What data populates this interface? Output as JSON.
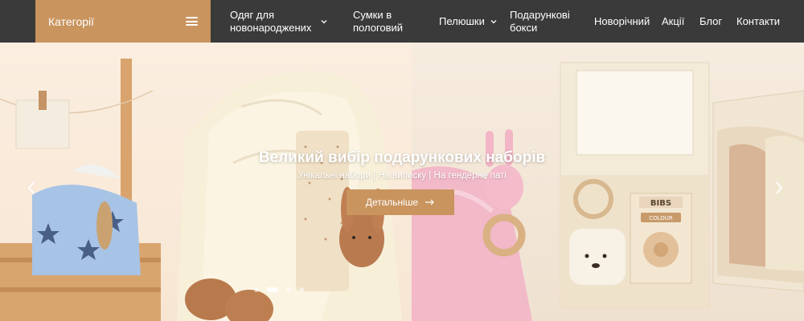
{
  "header": {
    "categories_label": "Категорії",
    "nav": [
      {
        "label_line1": "Одяг для",
        "label_line2": "новонароджених",
        "has_dropdown": true
      },
      {
        "label_line1": "Сумки в",
        "label_line2": "пологовий",
        "has_dropdown": false
      },
      {
        "label_line1": "Пелюшки",
        "label_line2": "",
        "has_dropdown": true
      },
      {
        "label_line1": "Подарункові",
        "label_line2": "бокси",
        "has_dropdown": false
      },
      {
        "label_line1": "Новорічний",
        "label_line2": "",
        "has_dropdown": false
      },
      {
        "label_line1": "Акції",
        "label_line2": "",
        "has_dropdown": false
      },
      {
        "label_line1": "Блог",
        "label_line2": "",
        "has_dropdown": false
      },
      {
        "label_line1": "Контакти",
        "label_line2": "",
        "has_dropdown": false
      }
    ]
  },
  "hero": {
    "title": "Великий вибір подарункових наборів",
    "subtitle": "Унікальні набори | На виписку | На гендерне паті",
    "button_label": "Детальніше",
    "slide_count": 4,
    "active_slide": 2,
    "icons": {
      "prev": "chevron-left-icon",
      "next": "chevron-right-icon",
      "button": "arrow-right-icon",
      "menu": "hamburger-icon"
    }
  },
  "colors": {
    "header_bg": "#3a3a3a",
    "accent": "#c9945e",
    "text_light": "#ffffff"
  }
}
